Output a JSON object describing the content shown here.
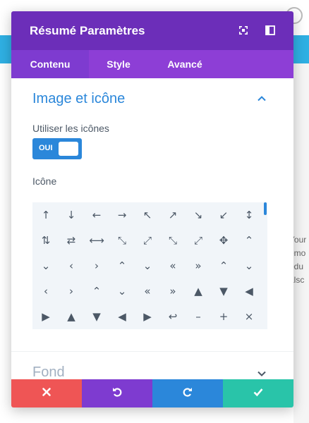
{
  "modal": {
    "title": "Résumé Paramètres",
    "header_icons": [
      "expand-icon",
      "split-view-icon"
    ]
  },
  "tabs": [
    {
      "label": "Contenu",
      "active": true
    },
    {
      "label": "Style",
      "active": false
    },
    {
      "label": "Avancé",
      "active": false
    }
  ],
  "section": {
    "title": "Image et icône",
    "use_icons_label": "Utiliser les icônes",
    "toggle_label": "OUI",
    "toggle_on": true,
    "icon_label": "Icône",
    "icons": [
      "↑",
      "↓",
      "←",
      "→",
      "↖",
      "↗",
      "↘",
      "↙",
      "↕",
      "⇅",
      "⇄",
      "⟷",
      "⤡",
      "⤢",
      "⤡",
      "⤢",
      "✥",
      "⌃",
      "⌄",
      "‹",
      "›",
      "⌃",
      "⌄",
      "«",
      "»",
      "⌃",
      "⌄",
      "‹",
      "›",
      "⌃",
      "⌄",
      "«",
      "»",
      "▲",
      "▼",
      "◀",
      "▶",
      "▲",
      "▼",
      "◀",
      "▶",
      "↩",
      "–",
      "+",
      "×"
    ]
  },
  "collapsed_section": {
    "title": "Fond"
  },
  "footer": {
    "buttons": [
      {
        "name": "cancel",
        "icon": "close-icon",
        "color": "#ef5555"
      },
      {
        "name": "undo",
        "icon": "undo-icon",
        "color": "#7e3bd0"
      },
      {
        "name": "redo",
        "icon": "redo-icon",
        "color": "#2b87da"
      },
      {
        "name": "save",
        "icon": "check-icon",
        "color": "#29c4a9"
      }
    ]
  },
  "colors": {
    "header": "#6c2eb9",
    "tabs": "#8d3ed6",
    "accent": "#2b87da"
  },
  "background_text": [
    "Your",
    "emo",
    "odu",
    "alsc"
  ]
}
